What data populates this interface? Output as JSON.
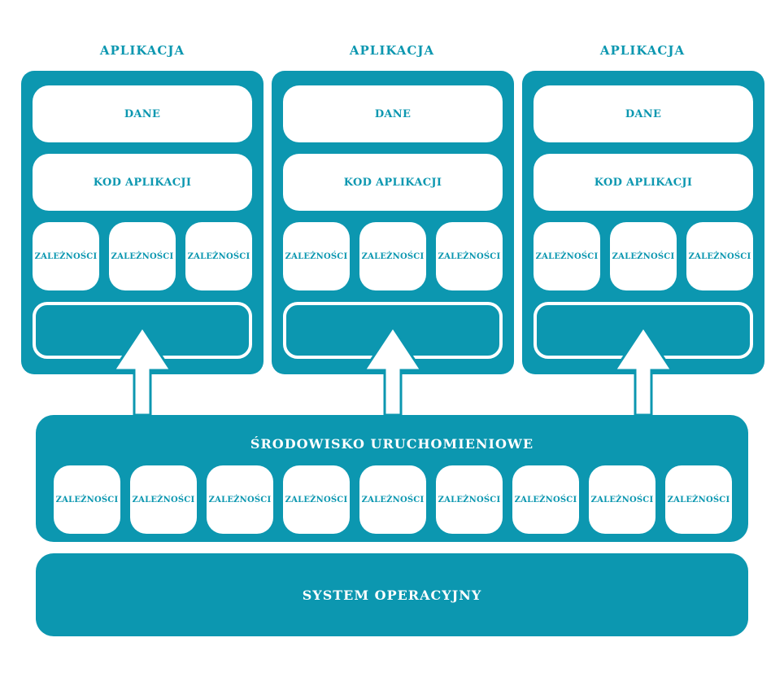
{
  "apps": [
    {
      "title": "APLIKACJA",
      "data_label": "DANE",
      "code_label": "KOD APLIKACJI",
      "deps": [
        "ZALEŻNOŚCI",
        "ZALEŻNOŚCI",
        "ZALEŻNOŚCI"
      ]
    },
    {
      "title": "APLIKACJA",
      "data_label": "DANE",
      "code_label": "KOD APLIKACJI",
      "deps": [
        "ZALEŻNOŚCI",
        "ZALEŻNOŚCI",
        "ZALEŻNOŚCI"
      ]
    },
    {
      "title": "APLIKACJA",
      "data_label": "DANE",
      "code_label": "KOD APLIKACJI",
      "deps": [
        "ZALEŻNOŚCI",
        "ZALEŻNOŚCI",
        "ZALEŻNOŚCI"
      ]
    }
  ],
  "runtime": {
    "title": "ŚRODOWISKO URUCHOMIENIOWE",
    "deps": [
      "ZALEŻNOŚCI",
      "ZALEŻNOŚCI",
      "ZALEŻNOŚCI",
      "ZALEŻNOŚCI",
      "ZALEŻNOŚCI",
      "ZALEŻNOŚCI",
      "ZALEŻNOŚCI",
      "ZALEŻNOŚCI",
      "ZALEŻNOŚCI"
    ]
  },
  "os": {
    "label": "SYSTEM OPERACYJNY"
  },
  "colors": {
    "accent": "#0c97b0",
    "box": "#ffffff"
  }
}
